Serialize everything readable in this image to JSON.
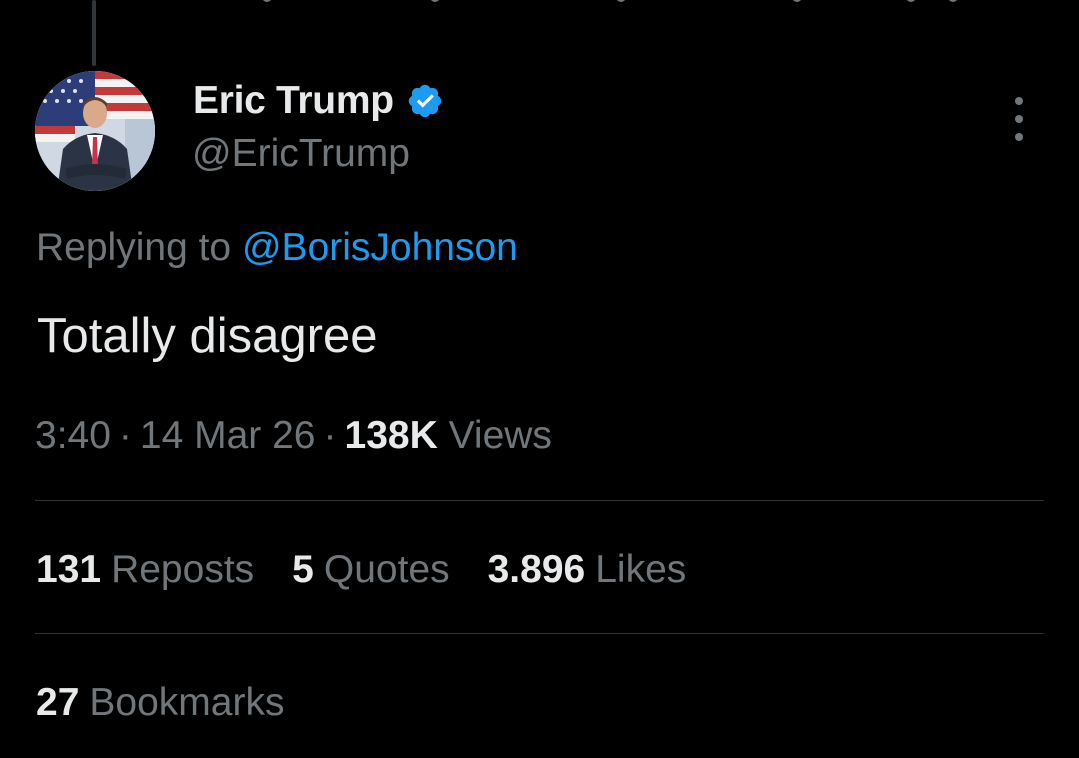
{
  "author": {
    "display_name": "Eric Trump",
    "handle": "@EricTrump",
    "verified_icon": "verified-badge-icon",
    "avatar": "profile-photo"
  },
  "reply": {
    "prefix": "Replying to",
    "mention": "@BorisJohnson"
  },
  "tweet": {
    "text": "Totally disagree"
  },
  "meta": {
    "time": "3:40",
    "separator": "·",
    "date": "14 Mar 26",
    "views_count": "138K",
    "views_label": "Views"
  },
  "stats": {
    "reposts_count": "131",
    "reposts_label": "Reposts",
    "quotes_count": "5",
    "quotes_label": "Quotes",
    "likes_count": "3.896",
    "likes_label": "Likes",
    "bookmarks_count": "27",
    "bookmarks_label": "Bookmarks"
  },
  "colors": {
    "background": "#000000",
    "primary_text": "#e7e9ea",
    "secondary_text": "#71767b",
    "accent": "#1d9bf0",
    "divider": "#2f3336"
  }
}
